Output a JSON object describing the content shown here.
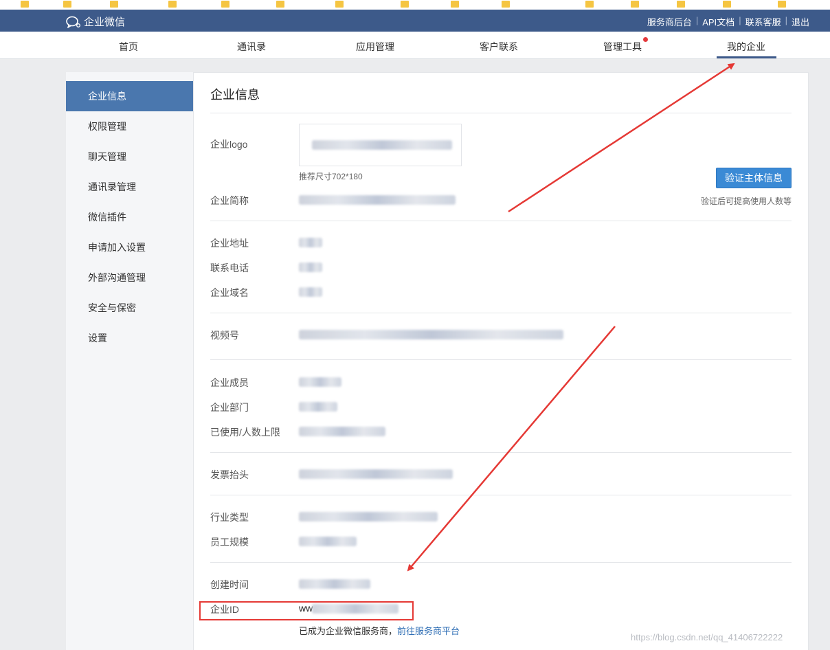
{
  "app": {
    "brand": "企业微信",
    "top_links": [
      "服务商后台",
      "API文档",
      "联系客服",
      "退出"
    ]
  },
  "nav": {
    "items": [
      "首页",
      "通讯录",
      "应用管理",
      "客户联系",
      "管理工具",
      "我的企业"
    ],
    "active": "我的企业"
  },
  "sidebar": {
    "items": [
      "企业信息",
      "权限管理",
      "聊天管理",
      "通讯录管理",
      "微信插件",
      "申请加入设置",
      "外部沟通管理",
      "安全与保密",
      "设置"
    ],
    "active": "企业信息"
  },
  "content": {
    "title": "企业信息",
    "logo_label": "企业logo",
    "logo_hint": "推荐尺寸702*180",
    "verify_button": "验证主体信息",
    "verify_hint": "验证后可提高使用人数等",
    "fields": {
      "short_name": "企业简称",
      "address": "企业地址",
      "phone": "联系电话",
      "domain": "企业域名",
      "video": "视频号",
      "members": "企业成员",
      "departments": "企业部门",
      "used_limit": "已使用/人数上限",
      "invoice": "发票抬头",
      "industry": "行业类型",
      "staff_size": "员工规模",
      "created": "创建时间",
      "corp_id": "企业ID"
    },
    "corp_id_prefix": "ww",
    "service_provider_text": "已成为企业微信服务商，",
    "service_provider_link": "前往服务商平台"
  },
  "watermark": "https://blog.csdn.net/qq_41406722222",
  "colors": {
    "topbar": "#3d5a8a",
    "sidebar_active": "#4a77ae",
    "button": "#3b8ad5",
    "annotation_red": "#e53935"
  }
}
